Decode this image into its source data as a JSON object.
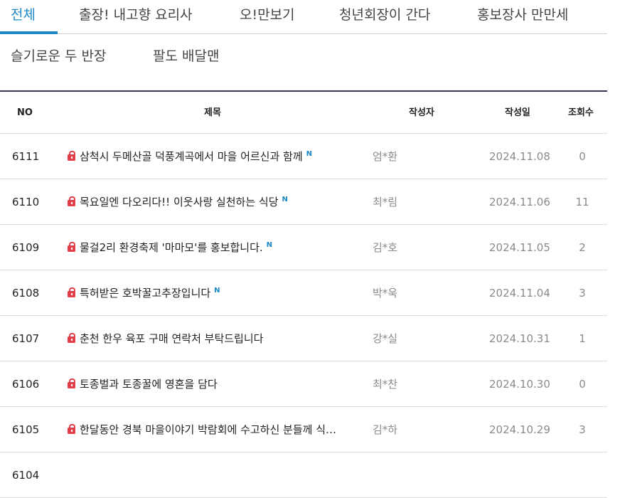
{
  "tabs": [
    {
      "label": "전체",
      "active": true
    },
    {
      "label": "출장! 내고향 요리사"
    },
    {
      "label": "오!만보기"
    },
    {
      "label": "청년회장이 간다"
    },
    {
      "label": "홍보장사 만만세"
    },
    {
      "label": "슬기로운 두 반장"
    },
    {
      "label": "팔도 배달맨"
    }
  ],
  "table": {
    "headers": {
      "no": "NO",
      "title": "제목",
      "author": "작성자",
      "date": "작성일",
      "views": "조회수"
    },
    "new_badge": "N",
    "rows": [
      {
        "no": "6111",
        "title": "삼척시 두메산골 덕풍계곡에서 마을 어르신과 함께",
        "new": true,
        "author": "엄*환",
        "date": "2024.11.08",
        "views": "0"
      },
      {
        "no": "6110",
        "title": "목요일엔 다오리다!! 이웃사랑 실천하는 식당",
        "new": true,
        "author": "최*림",
        "date": "2024.11.06",
        "views": "11"
      },
      {
        "no": "6109",
        "title": "물걸2리 환경축제 '마마모'를 홍보합니다.",
        "new": true,
        "author": "김*호",
        "date": "2024.11.05",
        "views": "2"
      },
      {
        "no": "6108",
        "title": "특허받은 호박꿀고추장입니다",
        "new": true,
        "author": "박*욱",
        "date": "2024.11.04",
        "views": "3"
      },
      {
        "no": "6107",
        "title": "춘천 한우 육포 구매 연락처 부탁드립니다",
        "new": false,
        "author": "강*실",
        "date": "2024.10.31",
        "views": "1"
      },
      {
        "no": "6106",
        "title": "토종벌과 토종꿀에 영혼을 담다",
        "new": false,
        "author": "최*찬",
        "date": "2024.10.30",
        "views": "0"
      },
      {
        "no": "6105",
        "title": "한달동안 경북 마을이야기 박람회에 수고하신 분들께 식…",
        "new": false,
        "author": "김*하",
        "date": "2024.10.29",
        "views": "3"
      },
      {
        "no": "6104",
        "title": "",
        "new": false,
        "author": "",
        "date": "",
        "views": ""
      }
    ]
  },
  "colors": {
    "accent": "#1e88c7",
    "lock": "#e0404a",
    "board_top": "#3a3552"
  }
}
